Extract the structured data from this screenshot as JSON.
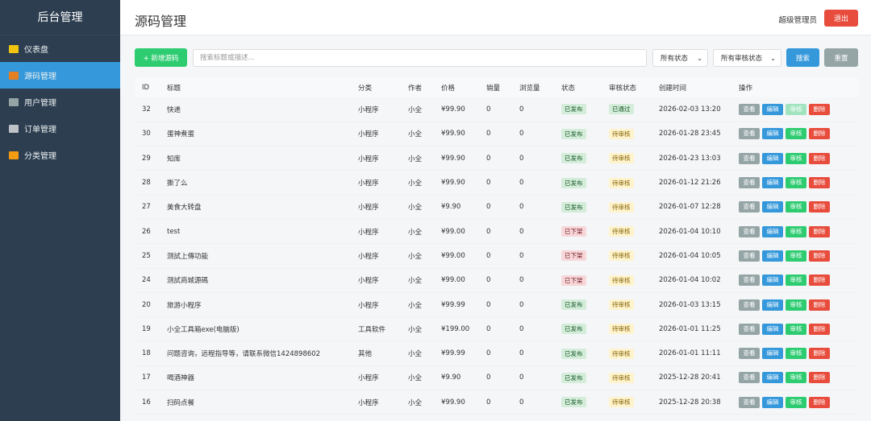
{
  "sidebar": {
    "title": "后台管理",
    "items": [
      {
        "label": "仪表盘",
        "icon": "chart-icon",
        "color": "#f1c40f"
      },
      {
        "label": "源码管理",
        "icon": "book-icon",
        "color": "#e67e22"
      },
      {
        "label": "用户管理",
        "icon": "user-icon",
        "color": "#95a5a6"
      },
      {
        "label": "订单管理",
        "icon": "clipboard-icon",
        "color": "#bdc3c7"
      },
      {
        "label": "分类管理",
        "icon": "folder-icon",
        "color": "#f39c12"
      }
    ],
    "active_index": 1
  },
  "header": {
    "title": "源码管理",
    "user": "超级管理员",
    "logout": "退出"
  },
  "toolbar": {
    "add_label": "+ 新增源码",
    "search_placeholder": "搜索标题或描述...",
    "status_select": "所有状态",
    "audit_select": "所有审核状态",
    "search_label": "搜索",
    "reset_label": "重置"
  },
  "table": {
    "headers": [
      "ID",
      "标题",
      "分类",
      "作者",
      "价格",
      "销量",
      "浏览量",
      "状态",
      "审核状态",
      "创建时间",
      "操作"
    ],
    "actions": {
      "view": "查看",
      "edit": "编辑",
      "audit": "审核",
      "delete": "删除"
    },
    "rows": [
      {
        "id": "32",
        "title": "快递",
        "category": "小程序",
        "author": "小全",
        "price": "¥99.90",
        "sales": "0",
        "views": "0",
        "status": "已发布",
        "audit": "已通过",
        "created": "2026-02-03 13:20"
      },
      {
        "id": "30",
        "title": "蛋神煮蛋",
        "category": "小程序",
        "author": "小全",
        "price": "¥99.90",
        "sales": "0",
        "views": "0",
        "status": "已发布",
        "audit": "待审核",
        "created": "2026-01-28 23:45"
      },
      {
        "id": "29",
        "title": "知库",
        "category": "小程序",
        "author": "小全",
        "price": "¥99.90",
        "sales": "0",
        "views": "0",
        "status": "已发布",
        "audit": "待审核",
        "created": "2026-01-23 13:03"
      },
      {
        "id": "28",
        "title": "撕了么",
        "category": "小程序",
        "author": "小全",
        "price": "¥99.90",
        "sales": "0",
        "views": "0",
        "status": "已发布",
        "audit": "待审核",
        "created": "2026-01-12 21:26"
      },
      {
        "id": "27",
        "title": "美食大转盘",
        "category": "小程序",
        "author": "小全",
        "price": "¥9.90",
        "sales": "0",
        "views": "0",
        "status": "已发布",
        "audit": "待审核",
        "created": "2026-01-07 12:28"
      },
      {
        "id": "26",
        "title": "test",
        "category": "小程序",
        "author": "小全",
        "price": "¥99.00",
        "sales": "0",
        "views": "0",
        "status": "已下架",
        "audit": "待审核",
        "created": "2026-01-04 10:10"
      },
      {
        "id": "25",
        "title": "测試上傳功能",
        "category": "小程序",
        "author": "小全",
        "price": "¥99.00",
        "sales": "0",
        "views": "0",
        "status": "已下架",
        "audit": "待审核",
        "created": "2026-01-04 10:05"
      },
      {
        "id": "24",
        "title": "测試商城源碼",
        "category": "小程序",
        "author": "小全",
        "price": "¥99.00",
        "sales": "0",
        "views": "0",
        "status": "已下架",
        "audit": "待审核",
        "created": "2026-01-04 10:02"
      },
      {
        "id": "20",
        "title": "旅游小程序",
        "category": "小程序",
        "author": "小全",
        "price": "¥99.99",
        "sales": "0",
        "views": "0",
        "status": "已发布",
        "audit": "待审核",
        "created": "2026-01-03 13:15"
      },
      {
        "id": "19",
        "title": "小全工具箱exe(电脑版)",
        "category": "工具软件",
        "author": "小全",
        "price": "¥199.00",
        "sales": "0",
        "views": "0",
        "status": "已发布",
        "audit": "待审核",
        "created": "2026-01-01 11:25"
      },
      {
        "id": "18",
        "title": "问题咨询，远程指导等，请联系微信1424898602",
        "category": "其他",
        "author": "小全",
        "price": "¥99.99",
        "sales": "0",
        "views": "0",
        "status": "已发布",
        "audit": "待审核",
        "created": "2026-01-01 11:11"
      },
      {
        "id": "17",
        "title": "喝酒神器",
        "category": "小程序",
        "author": "小全",
        "price": "¥9.90",
        "sales": "0",
        "views": "0",
        "status": "已发布",
        "audit": "待审核",
        "created": "2025-12-28 20:41"
      },
      {
        "id": "16",
        "title": "扫码点餐",
        "category": "小程序",
        "author": "小全",
        "price": "¥99.90",
        "sales": "0",
        "views": "0",
        "status": "已发布",
        "audit": "待审核",
        "created": "2025-12-28 20:38"
      }
    ]
  }
}
